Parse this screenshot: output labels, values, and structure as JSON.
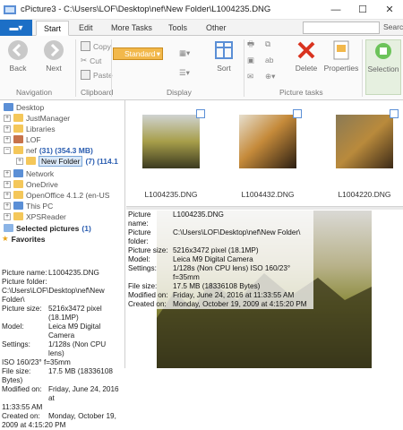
{
  "window": {
    "title": "cPicture3 - C:\\Users\\LOF\\Desktop\\nef\\New Folder\\L1004235.DNG"
  },
  "tabs": [
    {
      "label": "Start"
    },
    {
      "label": "Edit"
    },
    {
      "label": "More Tasks"
    },
    {
      "label": "Tools"
    },
    {
      "label": "Other"
    }
  ],
  "search": {
    "label": "Searc"
  },
  "ribbon": {
    "navigation": {
      "label": "Navigation",
      "back": "Back",
      "next": "Next"
    },
    "clipboard": {
      "label": "Clipboard",
      "copy": "Copy",
      "cut": "Cut",
      "paste": "Paste"
    },
    "display": {
      "label": "Display",
      "standard": "Standard",
      "sort": "Sort"
    },
    "picture_tasks": {
      "label": "Picture tasks",
      "delete": "Delete",
      "properties": "Properties",
      "selection": "Selection"
    }
  },
  "tree": [
    {
      "label": "Desktop"
    },
    {
      "label": "JustManager"
    },
    {
      "label": "Libraries"
    },
    {
      "label": "LOF"
    },
    {
      "label": "nef",
      "count": "(31) (354.3 MB)"
    },
    {
      "label": "New Folder",
      "count": "(7) (114.1"
    },
    {
      "label": "Network"
    },
    {
      "label": "OneDrive"
    },
    {
      "label": "OpenOffice 4.1.2 (en-US"
    },
    {
      "label": "This PC"
    },
    {
      "label": "XPSReader"
    }
  ],
  "selected_pictures": {
    "label": "Selected pictures",
    "count": "(1)"
  },
  "favorites": {
    "label": "Favorites"
  },
  "left_props": [
    {
      "k": "Picture name:",
      "v": "L1004235.DNG"
    },
    {
      "k": "Picture folder:",
      "v": ""
    },
    {
      "k": "",
      "v": "C:\\Users\\LOF\\Desktop\\nef\\New Folder\\"
    },
    {
      "k": "Picture size:",
      "v": "5216x3472 pixel (18.1MP)"
    },
    {
      "k": "Model:",
      "v": "Leica M9 Digital Camera"
    },
    {
      "k": "Settings:",
      "v": "1/128s (Non CPU lens)"
    },
    {
      "k": "",
      "v": "ISO 160/23° f=35mm"
    },
    {
      "k": "File size:",
      "v": "17.5 MB (18336108"
    },
    {
      "k": "",
      "v": "Bytes)"
    },
    {
      "k": "Modified on:",
      "v": "Friday, June 24, 2016 at"
    },
    {
      "k": "",
      "v": "11:33:55 AM"
    },
    {
      "k": "Created on:",
      "v": "Monday, October 19,"
    },
    {
      "k": "",
      "v": "2009 at 4:15:20 PM"
    }
  ],
  "thumbnails": [
    {
      "caption": "L1004235.DNG"
    },
    {
      "caption": "L1004432.DNG"
    },
    {
      "caption": "L1004220.DNG"
    }
  ],
  "preview_props": [
    {
      "k": "Picture name:",
      "v": "L1004235.DNG"
    },
    {
      "k": "Picture folder:",
      "v": "C:\\Users\\LOF\\Desktop\\nef\\New Folder\\"
    },
    {
      "k": "Picture size:",
      "v": "5216x3472 pixel (18.1MP)"
    },
    {
      "k": "Model:",
      "v": "Leica M9 Digital Camera"
    },
    {
      "k": "Settings:",
      "v": "1/128s (Non CPU lens) ISO 160/23° f=35mm"
    },
    {
      "k": "File size:",
      "v": "17.5 MB (18336108 Bytes)"
    },
    {
      "k": "Modified on:",
      "v": "Friday, June 24, 2016 at 11:33:55 AM"
    },
    {
      "k": "Created on:",
      "v": "Monday, October 19, 2009 at 4:15:20 PM"
    }
  ]
}
